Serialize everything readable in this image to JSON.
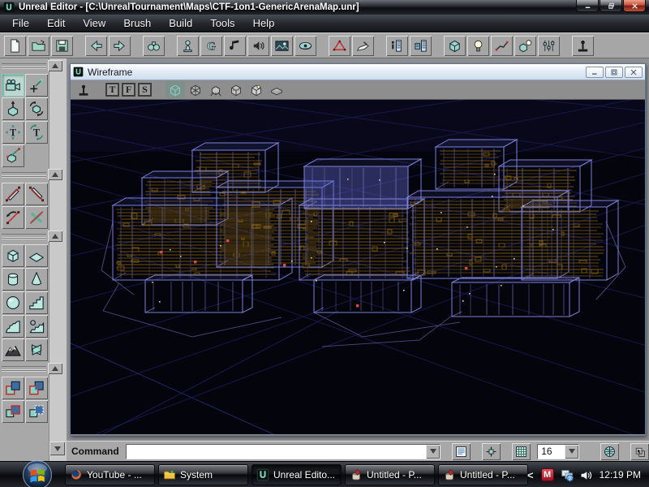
{
  "window": {
    "title": "Unreal Editor - [C:\\UnrealTournament\\Maps\\CTF-1on1-GenericArenaMap.unr]"
  },
  "menu": {
    "items": [
      "File",
      "Edit",
      "View",
      "Brush",
      "Build",
      "Tools",
      "Help"
    ]
  },
  "main_toolbar": {
    "groups": [
      [
        "file-new",
        "file-open",
        "file-save"
      ],
      [
        "undo",
        "redo"
      ],
      [
        "search"
      ],
      [
        "browser-actors",
        "browser-groups",
        "browser-music",
        "browser-sounds",
        "browser-textures",
        "browser-meshes"
      ],
      [
        "shape-editor-2d",
        "surface-properties"
      ],
      [
        "actor-properties",
        "level-properties"
      ],
      [
        "build-geometry",
        "build-lighting",
        "build-paths",
        "build-all",
        "build-options"
      ],
      [
        "play-map"
      ]
    ],
    "group_browser_letter": "G"
  },
  "toolbox": {
    "selected": "camera-mode",
    "groups": [
      {
        "tools": [
          "camera-mode",
          "actor-move",
          "brush-scale",
          "brush-rotate",
          "texture-pan",
          "texture-rotate",
          "brush-snap"
        ]
      },
      {
        "tools": [
          "clip-marker",
          "clip-marker-2",
          "clip-rotate",
          "clip-delete"
        ]
      },
      {
        "tools": [
          "brush-cube",
          "brush-sheet",
          "brush-cylinder",
          "brush-cone",
          "brush-sphere",
          "brush-stairs",
          "brush-curved-stairs",
          "brush-spiral-stairs",
          "brush-terrain",
          "brush-volumetric"
        ]
      },
      {
        "tools": [
          "csg-add",
          "csg-subtract",
          "csg-intersect",
          "csg-deintersect"
        ]
      }
    ]
  },
  "viewport": {
    "title": "Wireframe",
    "letters": [
      "T",
      "F",
      "S"
    ],
    "modes": [
      "wireframe",
      "zones",
      "ortho",
      "textured",
      "lit",
      "flat"
    ],
    "active_mode": "wireframe",
    "scene": {
      "background": "#04040c",
      "grid_line": "#17174a",
      "wire_primary": "#7d82d8",
      "wire_secondary": "#7c5a12",
      "marker_red": "#e04848"
    }
  },
  "command_bar": {
    "label": "Command",
    "value": "",
    "grid_size": "16",
    "mid_icons": [
      "log-window",
      "vertex-snap",
      "grid-toggle"
    ],
    "far_icons": [
      "draw-region",
      "select-mode"
    ]
  },
  "taskbar": {
    "buttons": [
      {
        "label": "YouTube - ...",
        "icon": "firefox",
        "active": false
      },
      {
        "label": "System",
        "icon": "folder",
        "active": false
      },
      {
        "label": "Unreal Edito...",
        "icon": "unreal",
        "active": true
      },
      {
        "label": "Untitled - P...",
        "icon": "paint",
        "active": false
      },
      {
        "label": "Untitled - P...",
        "icon": "paint",
        "active": false
      }
    ],
    "tray": {
      "collapse_glyph": "<",
      "mcafee_letter": "M",
      "clock": "12:19 PM"
    }
  }
}
